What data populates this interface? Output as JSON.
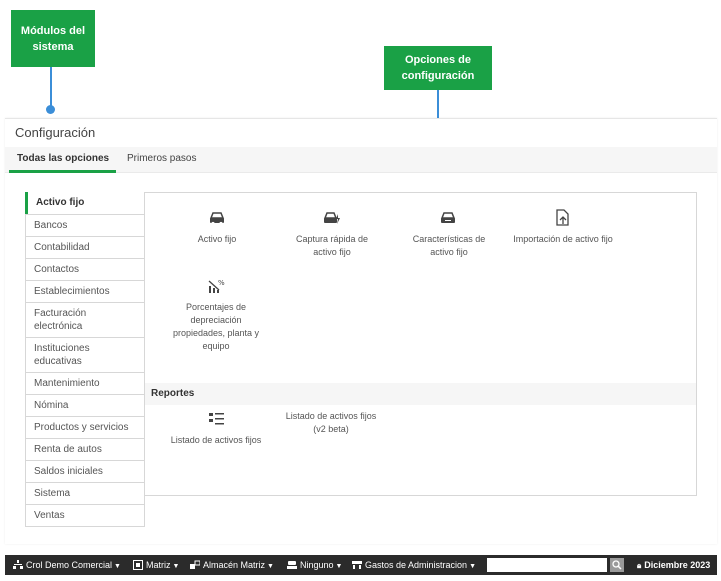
{
  "callouts": {
    "modules": "Módulos del sistema",
    "options": "Opciones de configuración"
  },
  "panel": {
    "title": "Configuración",
    "tabs": [
      {
        "label": "Todas las opciones",
        "active": true
      },
      {
        "label": "Primeros pasos",
        "active": false
      }
    ]
  },
  "sidebar": {
    "items": [
      {
        "label": "Activo fijo",
        "active": true
      },
      {
        "label": "Bancos"
      },
      {
        "label": "Contabilidad"
      },
      {
        "label": "Contactos"
      },
      {
        "label": "Establecimientos"
      },
      {
        "label": "Facturación electrónica"
      },
      {
        "label": "Instituciones educativas"
      },
      {
        "label": "Mantenimiento"
      },
      {
        "label": "Nómina"
      },
      {
        "label": "Productos y servicios"
      },
      {
        "label": "Renta de autos"
      },
      {
        "label": "Saldos iniciales"
      },
      {
        "label": "Sistema"
      },
      {
        "label": "Ventas"
      }
    ]
  },
  "options": [
    {
      "label": "Activo fijo",
      "icon": "car-icon"
    },
    {
      "label": "Captura rápida de activo fijo",
      "icon": "car-lightning-icon"
    },
    {
      "label": "Características de activo fijo",
      "icon": "car-list-icon"
    },
    {
      "label": "Importación de activo fijo",
      "icon": "file-import-icon"
    },
    {
      "label": "Porcentajes de depreciación propiedades, planta y equipo",
      "icon": "percent-chart-icon"
    }
  ],
  "reports": {
    "title": "Reportes",
    "items": [
      {
        "label": "Listado de activos fijos",
        "icon": "list-car-icon"
      },
      {
        "label": "Listado de activos fijos (v2 beta)",
        "icon": ""
      }
    ]
  },
  "taskbar": {
    "company": "Crol Demo Comercial",
    "branch": "Matriz",
    "warehouse": "Almacén Matriz",
    "cash": "Ninguno",
    "cost_center": "Gastos de Administracion",
    "period": "Diciembre 2023"
  },
  "colors": {
    "accent": "#1aa146",
    "pointer": "#3b8ed8",
    "taskbar": "#2b2b2b"
  }
}
